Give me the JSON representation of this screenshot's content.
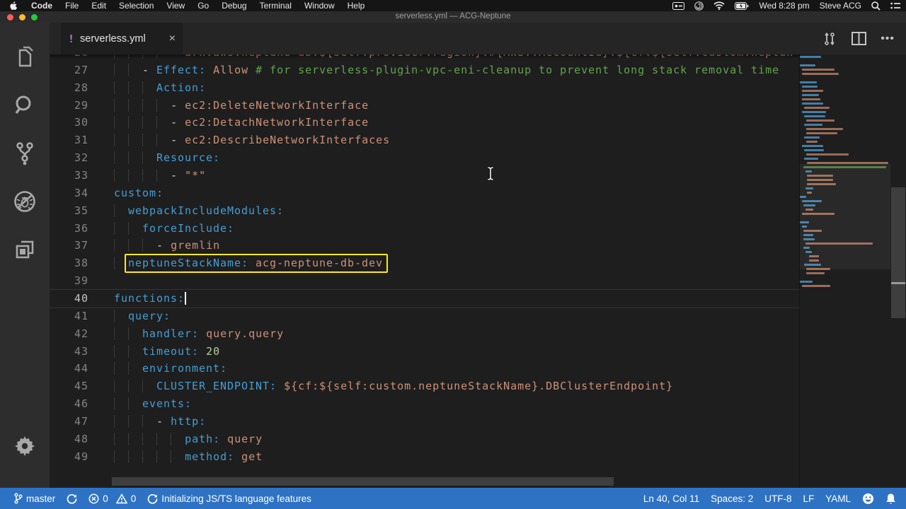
{
  "menubar": {
    "items": [
      "Code",
      "File",
      "Edit",
      "Selection",
      "View",
      "Go",
      "Debug",
      "Terminal",
      "Window",
      "Help"
    ],
    "clock": "Wed 8:28 pm",
    "user": "Steve ACG"
  },
  "titlebar": {
    "title": "serverless.yml — ACG-Neptune"
  },
  "tab": {
    "label": "serverless.yml",
    "close": "×",
    "badge": "!"
  },
  "editor": {
    "cursor_line": 40,
    "lines": [
      {
        "n": 26,
        "tokens": [
          {
            "t": "        ",
            "c": ""
          },
          {
            "t": "- ",
            "c": "p"
          },
          {
            "t": "arn:aws:neptune-db:${self:provider.region}:#{AWS::AccountId}:${cf:${self:custom.neptun",
            "c": "v"
          }
        ]
      },
      {
        "n": 27,
        "tokens": [
          {
            "t": "    ",
            "c": ""
          },
          {
            "t": "- ",
            "c": "p"
          },
          {
            "t": "Effect:",
            "c": "k"
          },
          {
            "t": " ",
            "c": "p"
          },
          {
            "t": "Allow ",
            "c": "v"
          },
          {
            "t": "# for serverless-plugin-vpc-eni-cleanup to prevent long stack removal time",
            "c": "c"
          }
        ]
      },
      {
        "n": 28,
        "tokens": [
          {
            "t": "      ",
            "c": ""
          },
          {
            "t": "Action:",
            "c": "k"
          }
        ]
      },
      {
        "n": 29,
        "tokens": [
          {
            "t": "        ",
            "c": ""
          },
          {
            "t": "- ",
            "c": "p"
          },
          {
            "t": "ec2:DeleteNetworkInterface",
            "c": "v"
          }
        ]
      },
      {
        "n": 30,
        "tokens": [
          {
            "t": "        ",
            "c": ""
          },
          {
            "t": "- ",
            "c": "p"
          },
          {
            "t": "ec2:DetachNetworkInterface",
            "c": "v"
          }
        ]
      },
      {
        "n": 31,
        "tokens": [
          {
            "t": "        ",
            "c": ""
          },
          {
            "t": "- ",
            "c": "p"
          },
          {
            "t": "ec2:DescribeNetworkInterfaces",
            "c": "v"
          }
        ]
      },
      {
        "n": 32,
        "tokens": [
          {
            "t": "      ",
            "c": ""
          },
          {
            "t": "Resource:",
            "c": "k"
          }
        ]
      },
      {
        "n": 33,
        "tokens": [
          {
            "t": "        ",
            "c": ""
          },
          {
            "t": "- ",
            "c": "p"
          },
          {
            "t": "\"*\"",
            "c": "v"
          }
        ]
      },
      {
        "n": 34,
        "tokens": [
          {
            "t": "custom:",
            "c": "k"
          }
        ]
      },
      {
        "n": 35,
        "tokens": [
          {
            "t": "  ",
            "c": ""
          },
          {
            "t": "webpackIncludeModules:",
            "c": "k"
          }
        ]
      },
      {
        "n": 36,
        "tokens": [
          {
            "t": "    ",
            "c": ""
          },
          {
            "t": "forceInclude:",
            "c": "k"
          }
        ]
      },
      {
        "n": 37,
        "tokens": [
          {
            "t": "      ",
            "c": ""
          },
          {
            "t": "- ",
            "c": "p"
          },
          {
            "t": "gremlin",
            "c": "v"
          }
        ]
      },
      {
        "n": 38,
        "highlight": true,
        "tokens": [
          {
            "t": "  ",
            "c": ""
          },
          {
            "t": "neptuneStackName:",
            "c": "k"
          },
          {
            "t": " ",
            "c": "p"
          },
          {
            "t": "acg-neptune-db-dev",
            "c": "v"
          }
        ]
      },
      {
        "n": 39,
        "tokens": []
      },
      {
        "n": 40,
        "cursor": true,
        "tokens": [
          {
            "t": "functions:",
            "c": "k"
          }
        ]
      },
      {
        "n": 41,
        "tokens": [
          {
            "t": "  ",
            "c": ""
          },
          {
            "t": "query:",
            "c": "k"
          }
        ]
      },
      {
        "n": 42,
        "tokens": [
          {
            "t": "    ",
            "c": ""
          },
          {
            "t": "handler:",
            "c": "k"
          },
          {
            "t": " ",
            "c": "p"
          },
          {
            "t": "query.query",
            "c": "v"
          }
        ]
      },
      {
        "n": 43,
        "tokens": [
          {
            "t": "    ",
            "c": ""
          },
          {
            "t": "timeout:",
            "c": "k"
          },
          {
            "t": " ",
            "c": "p"
          },
          {
            "t": "20",
            "c": "n"
          }
        ]
      },
      {
        "n": 44,
        "tokens": [
          {
            "t": "    ",
            "c": ""
          },
          {
            "t": "environment:",
            "c": "k"
          }
        ]
      },
      {
        "n": 45,
        "tokens": [
          {
            "t": "      ",
            "c": ""
          },
          {
            "t": "CLUSTER_ENDPOINT:",
            "c": "k"
          },
          {
            "t": " ",
            "c": "p"
          },
          {
            "t": "${cf:${self:custom.neptuneStackName}.DBClusterEndpoint}",
            "c": "v"
          }
        ]
      },
      {
        "n": 46,
        "tokens": [
          {
            "t": "    ",
            "c": ""
          },
          {
            "t": "events:",
            "c": "k"
          }
        ]
      },
      {
        "n": 47,
        "tokens": [
          {
            "t": "      ",
            "c": ""
          },
          {
            "t": "- ",
            "c": "p"
          },
          {
            "t": "http:",
            "c": "k"
          }
        ]
      },
      {
        "n": 48,
        "tokens": [
          {
            "t": "          ",
            "c": ""
          },
          {
            "t": "path:",
            "c": "k"
          },
          {
            "t": " ",
            "c": "p"
          },
          {
            "t": "query",
            "c": "v"
          }
        ]
      },
      {
        "n": 49,
        "tokens": [
          {
            "t": "          ",
            "c": ""
          },
          {
            "t": "method:",
            "c": "k"
          },
          {
            "t": " ",
            "c": "p"
          },
          {
            "t": "get",
            "c": "v"
          }
        ]
      }
    ],
    "minimap_head": [
      [
        0,
        30,
        "k"
      ],
      [
        0,
        0,
        ""
      ],
      [
        0,
        22,
        "k"
      ],
      [
        3,
        46,
        "v"
      ],
      [
        3,
        52,
        "v"
      ],
      [
        0,
        0,
        ""
      ],
      [
        0,
        24,
        "k"
      ],
      [
        3,
        22,
        "k"
      ],
      [
        3,
        30,
        "v"
      ],
      [
        3,
        24,
        "k"
      ],
      [
        3,
        26,
        "v"
      ],
      [
        3,
        30,
        "k"
      ],
      [
        6,
        36,
        "v"
      ],
      [
        3,
        34,
        "k"
      ],
      [
        6,
        30,
        "k"
      ],
      [
        9,
        40,
        "v"
      ],
      [
        6,
        26,
        "k"
      ],
      [
        9,
        52,
        "v"
      ],
      [
        9,
        44,
        "v"
      ],
      [
        6,
        22,
        "k"
      ],
      [
        9,
        16,
        "v"
      ],
      [
        3,
        30,
        "k"
      ],
      [
        6,
        28,
        "k"
      ],
      [
        9,
        60,
        "v"
      ],
      [
        6,
        20,
        "k"
      ]
    ],
    "minimap_tail": [
      [
        6,
        24,
        "k"
      ],
      [
        9,
        34,
        "v"
      ],
      [
        9,
        26,
        "v"
      ],
      [
        0,
        0,
        ""
      ],
      [
        0,
        18,
        "k"
      ],
      [
        3,
        40,
        "v"
      ]
    ]
  },
  "statusbar": {
    "branch": "master",
    "errors": "0",
    "warnings": "0",
    "message": "Initializing JS/TS language features",
    "line_col": "Ln 40, Col 11",
    "spaces": "Spaces: 2",
    "encoding": "UTF-8",
    "eol": "LF",
    "language": "YAML"
  },
  "colors": {
    "accent_blue": "#2e72c4",
    "highlight_yellow": "#ffe81a",
    "key_blue": "#459ed6",
    "string_orange": "#ce9178",
    "comment_green": "#64a24e"
  }
}
